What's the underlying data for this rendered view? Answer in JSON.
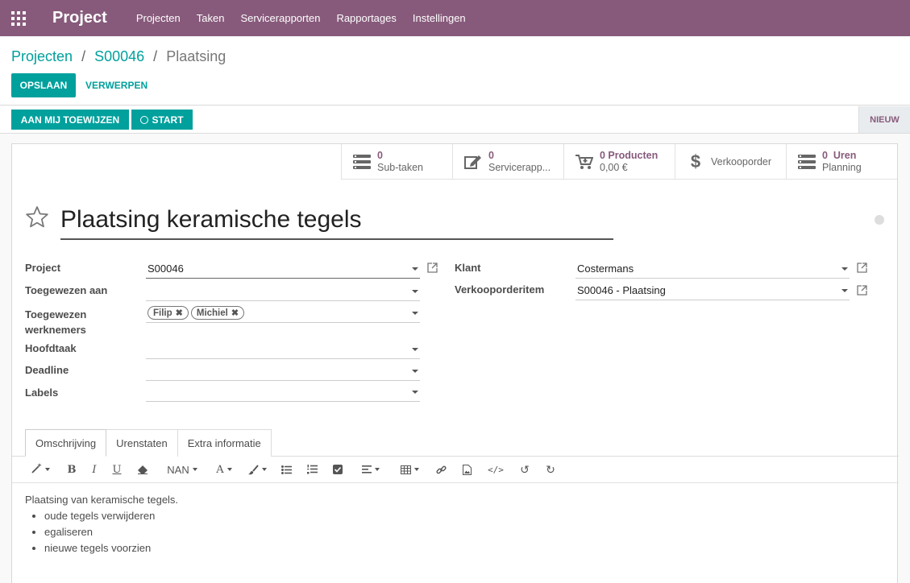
{
  "nav": {
    "app_name": "Project",
    "menu": [
      "Projecten",
      "Taken",
      "Servicerapporten",
      "Rapportages",
      "Instellingen"
    ],
    "apps_icon": "grid-icon",
    "bg_color": "#875a7b"
  },
  "breadcrumb": {
    "root": "Projecten",
    "sep1": "/",
    "project": "S00046",
    "sep2": "/",
    "current": "Plaatsing"
  },
  "actions": {
    "save": "OPSLAAN",
    "discard": "VERWERPEN"
  },
  "status": {
    "assign_me": "AAN MIJ TOEWIJZEN",
    "start": "START",
    "stage": "NIEUW"
  },
  "smart_buttons": {
    "subtasks": {
      "count": "0",
      "label": "Sub-taken"
    },
    "reports": {
      "count": "0",
      "label": "Servicerapp..."
    },
    "products": {
      "count": "0 Producten",
      "amount": "0,00 €"
    },
    "sale_order": {
      "label": "Verkooporder"
    },
    "planning": {
      "count": "0",
      "unit": "Uren",
      "label": "Planning"
    }
  },
  "task": {
    "title": "Plaatsing keramische tegels",
    "fields_left": [
      {
        "label": "Project",
        "value": "S00046"
      },
      {
        "label": "Toegewezen aan",
        "value": ""
      },
      {
        "label": "Toegewezen werknemers",
        "value": ""
      },
      {
        "label": "Hoofdtaak",
        "value": ""
      },
      {
        "label": "Deadline",
        "value": ""
      },
      {
        "label": "Labels",
        "value": ""
      }
    ],
    "employees": [
      "Filip",
      "Michiel"
    ],
    "fields_right": [
      {
        "label": "Klant",
        "value": "Costermans"
      },
      {
        "label": "Verkooporderitem",
        "value": "S00046 - Plaatsing"
      }
    ]
  },
  "tabs": [
    "Omschrijving",
    "Urenstaten",
    "Extra informatie"
  ],
  "editor": {
    "font_size": "NAN",
    "font_color_label": "A"
  },
  "description": {
    "intro": "Plaatsing van keramische tegels.",
    "items": [
      "oude tegels verwijderen",
      "egaliseren",
      "nieuwe tegels voorzien"
    ]
  },
  "colors": {
    "accent": "#00a09d",
    "brand": "#875a7b"
  }
}
